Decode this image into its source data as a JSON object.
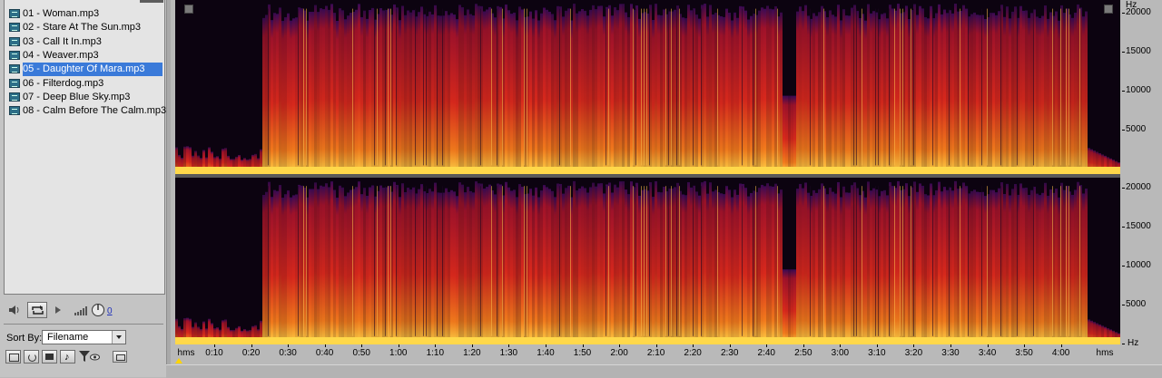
{
  "file_panel": {
    "files": [
      {
        "name": "01 - Woman.mp3",
        "selected": false
      },
      {
        "name": "02 - Stare At The Sun.mp3",
        "selected": false
      },
      {
        "name": "03 - Call It In.mp3",
        "selected": false
      },
      {
        "name": "04 - Weaver.mp3",
        "selected": false
      },
      {
        "name": "05 - Daughter Of Mara.mp3",
        "selected": true
      },
      {
        "name": "06 - Filterdog.mp3",
        "selected": false
      },
      {
        "name": "07 - Deep Blue Sky.mp3",
        "selected": false
      },
      {
        "name": "08 - Calm Before The Calm.mp3",
        "selected": false
      }
    ],
    "volume_value": "0",
    "sort_label": "Sort By:",
    "sort_value": "Filename",
    "icons": [
      "speaker-icon",
      "loop-icon",
      "play-icon",
      "volume-bars-icon",
      "volume-knob-icon"
    ]
  },
  "frequency_axis": {
    "labels": [
      "20000",
      "15000",
      "10000",
      "5000",
      "Hz"
    ],
    "unit": "Hz"
  },
  "time_axis": {
    "unit_label_left": "hms",
    "unit_label_right": "hms",
    "labels": [
      "0:10",
      "0:20",
      "0:30",
      "0:40",
      "0:50",
      "1:00",
      "1:10",
      "1:20",
      "1:30",
      "1:40",
      "1:50",
      "2:00",
      "2:10",
      "2:20",
      "2:30",
      "2:40",
      "2:50",
      "3:00",
      "3:10",
      "3:20",
      "3:30",
      "3:40",
      "3:50",
      "4:00"
    ]
  },
  "colors": {
    "spectrogram_low": "#0c0310",
    "spectrogram_mid": "#c2161f",
    "spectrogram_high": "#ffd84a",
    "selection": "#3a7ad9"
  }
}
